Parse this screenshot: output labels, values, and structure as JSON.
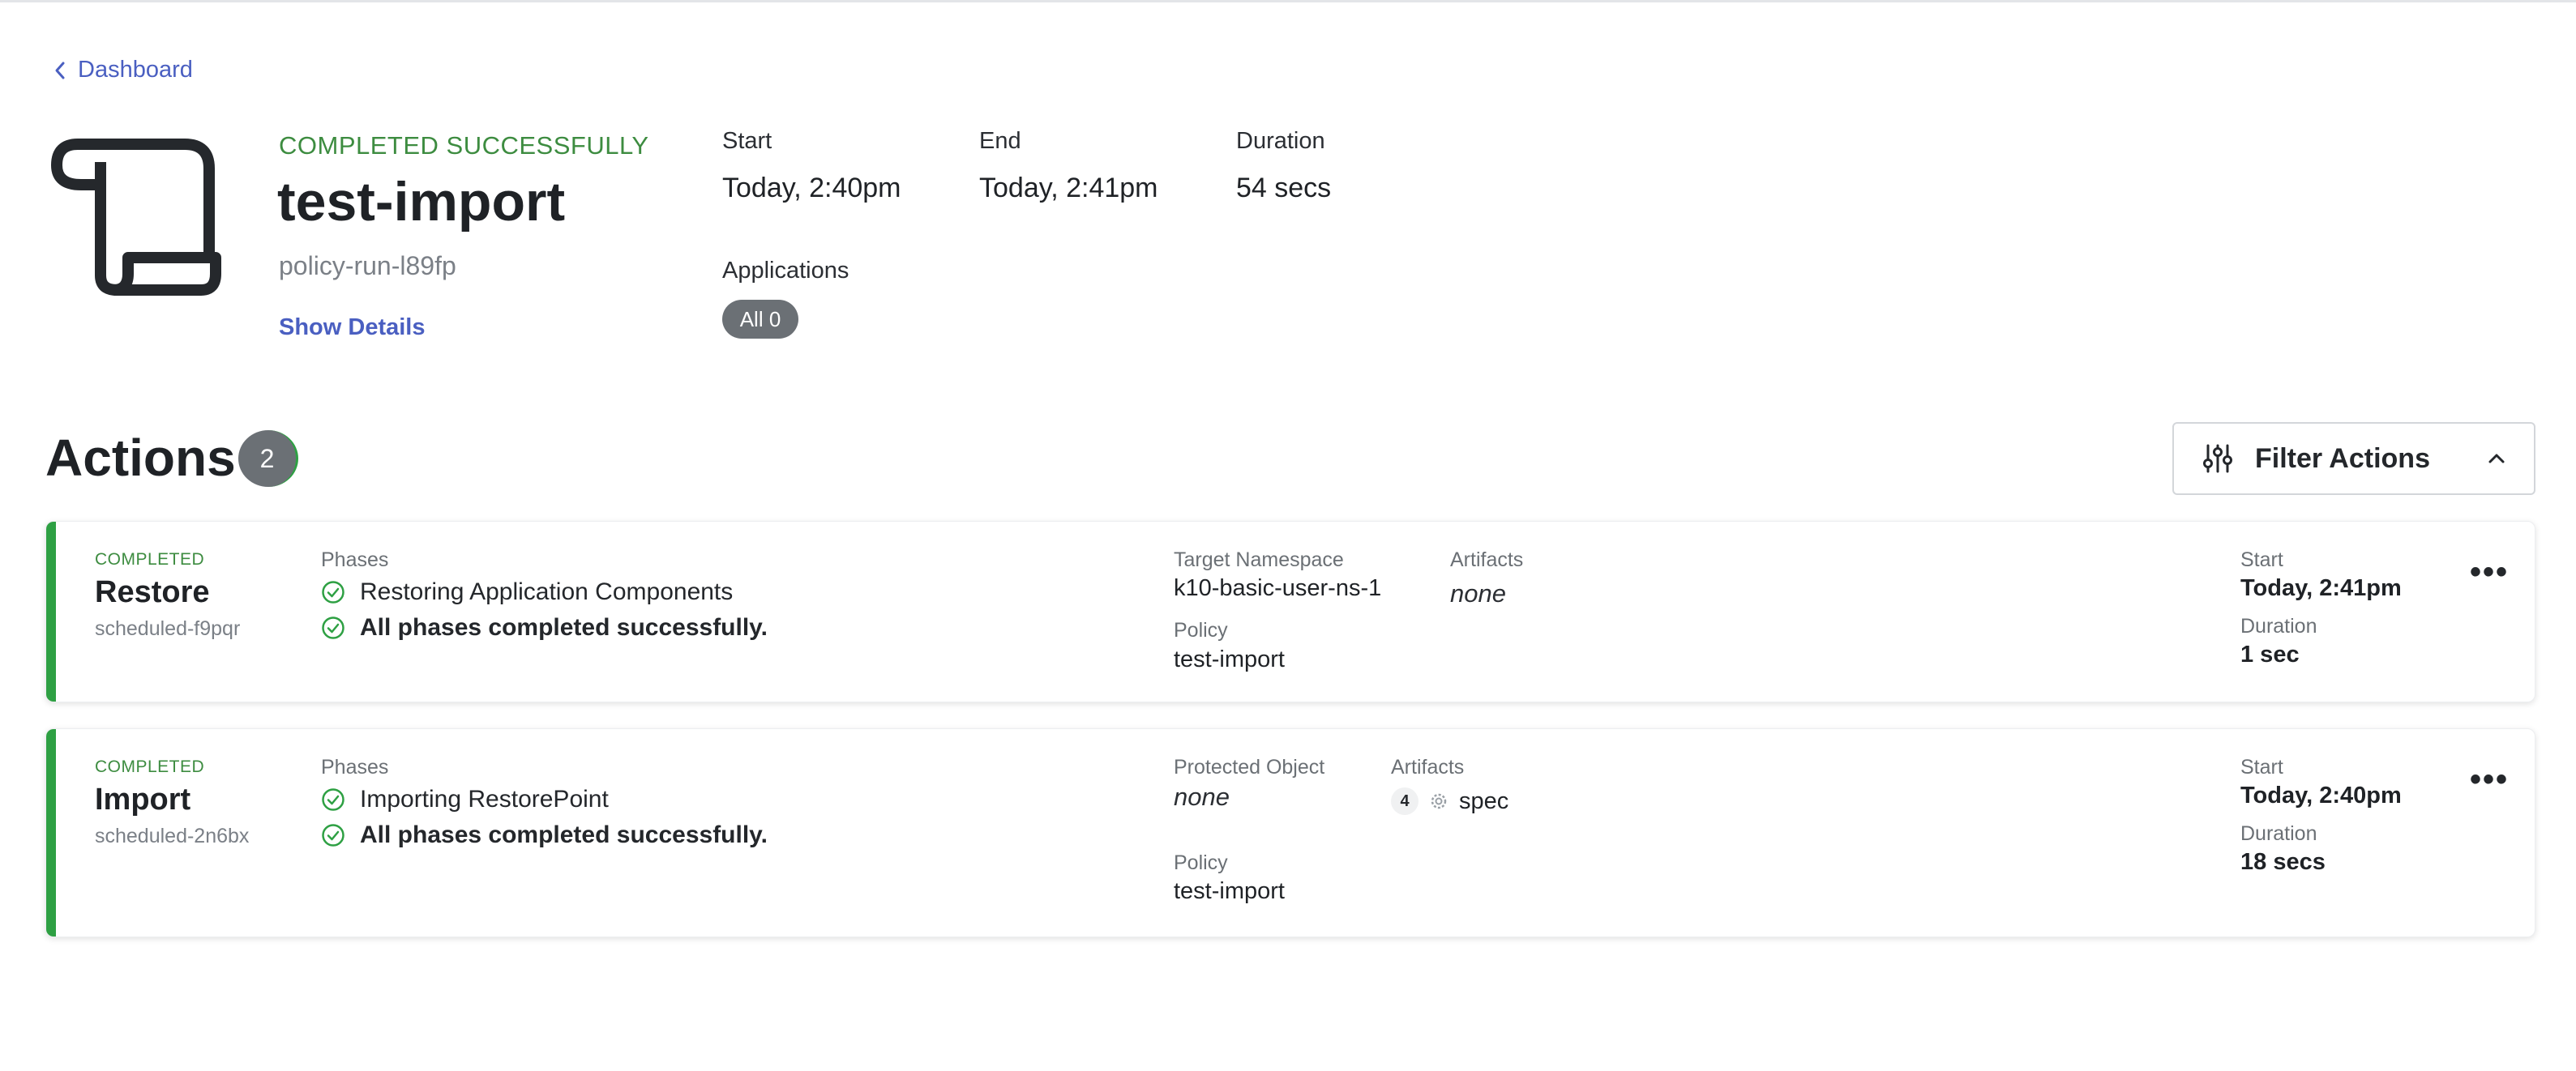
{
  "nav": {
    "back_label": "Dashboard"
  },
  "run": {
    "status": "COMPLETED SUCCESSFULLY",
    "title": "test-import",
    "subtitle": "policy-run-l89fp",
    "show_details": "Show Details"
  },
  "meta": {
    "start_label": "Start",
    "start_value": "Today, 2:40pm",
    "end_label": "End",
    "end_value": "Today, 2:41pm",
    "duration_label": "Duration",
    "duration_value": "54 secs",
    "applications_label": "Applications",
    "applications_pill": "All 0"
  },
  "actions": {
    "title": "Actions",
    "count": "2",
    "filter_label": "Filter Actions",
    "items": [
      {
        "status": "COMPLETED",
        "name": "Restore",
        "id": "scheduled-f9pqr",
        "phases_label": "Phases",
        "phases": [
          "Restoring Application Components",
          "All phases completed successfully."
        ],
        "field1_label": "Target Namespace",
        "field1_value": "k10-basic-user-ns-1",
        "artifacts_label": "Artifacts",
        "artifacts_value": "none",
        "policy_label": "Policy",
        "policy_value": "test-import",
        "start_label": "Start",
        "start_value": "Today, 2:41pm",
        "duration_label": "Duration",
        "duration_value": "1 sec"
      },
      {
        "status": "COMPLETED",
        "name": "Import",
        "id": "scheduled-2n6bx",
        "phases_label": "Phases",
        "phases": [
          "Importing RestorePoint",
          "All phases completed successfully."
        ],
        "field1_label": "Protected Object",
        "field1_value": "none",
        "artifacts_label": "Artifacts",
        "artifacts_count": "4",
        "artifacts_value": "spec",
        "policy_label": "Policy",
        "policy_value": "test-import",
        "start_label": "Start",
        "start_value": "Today, 2:40pm",
        "duration_label": "Duration",
        "duration_value": "18 secs"
      }
    ]
  },
  "colors": {
    "success": "#2ea043",
    "link": "#4a5fc1",
    "pill": "#6b7075"
  },
  "icons": [
    "chevron-left-icon",
    "scroll-icon",
    "sliders-icon",
    "chevron-up-icon",
    "check-circle-icon",
    "gear-icon",
    "more-horizontal-icon"
  ]
}
